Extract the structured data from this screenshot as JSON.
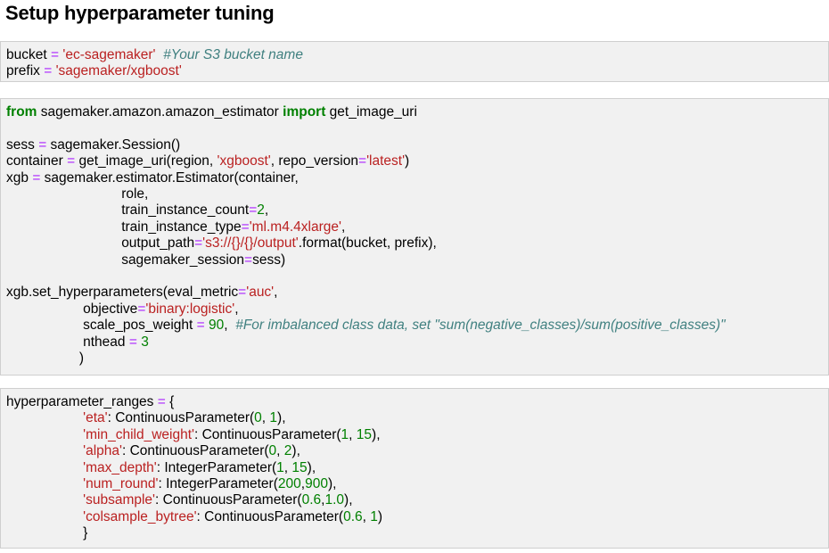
{
  "heading": "Setup hyperparameter tuning",
  "cells": [
    [
      [
        [
          "t",
          "bucket "
        ],
        [
          "op",
          "="
        ],
        [
          "t",
          " "
        ],
        [
          "str",
          "'ec-sagemaker'"
        ],
        [
          "t",
          "  "
        ],
        [
          "cm",
          "#Your S3 bucket name"
        ]
      ],
      [
        [
          "t",
          "prefix "
        ],
        [
          "op",
          "="
        ],
        [
          "t",
          " "
        ],
        [
          "str",
          "'sagemaker/xgboost'"
        ]
      ]
    ],
    [
      [
        [
          "kw",
          "from"
        ],
        [
          "t",
          " sagemaker.amazon.amazon_estimator "
        ],
        [
          "kw",
          "import"
        ],
        [
          "t",
          " get_image_uri"
        ]
      ],
      [],
      [
        [
          "t",
          "sess "
        ],
        [
          "op",
          "="
        ],
        [
          "t",
          " sagemaker.Session()"
        ]
      ],
      [
        [
          "t",
          "container "
        ],
        [
          "op",
          "="
        ],
        [
          "t",
          " get_image_uri(region, "
        ],
        [
          "str",
          "'xgboost'"
        ],
        [
          "t",
          ", repo_version"
        ],
        [
          "op",
          "="
        ],
        [
          "str",
          "'latest'"
        ],
        [
          "t",
          ")"
        ]
      ],
      [
        [
          "t",
          "xgb "
        ],
        [
          "op",
          "="
        ],
        [
          "t",
          " sagemaker.estimator.Estimator(container,"
        ]
      ],
      [
        [
          "t",
          "                              role,"
        ]
      ],
      [
        [
          "t",
          "                              train_instance_count"
        ],
        [
          "op",
          "="
        ],
        [
          "num",
          "2"
        ],
        [
          "t",
          ","
        ]
      ],
      [
        [
          "t",
          "                              train_instance_type"
        ],
        [
          "op",
          "="
        ],
        [
          "str",
          "'ml.m4.4xlarge'"
        ],
        [
          "t",
          ","
        ]
      ],
      [
        [
          "t",
          "                              output_path"
        ],
        [
          "op",
          "="
        ],
        [
          "str",
          "'s3://{}/{}/output'"
        ],
        [
          "t",
          ".format(bucket, prefix),"
        ]
      ],
      [
        [
          "t",
          "                              sagemaker_session"
        ],
        [
          "op",
          "="
        ],
        [
          "t",
          "sess)"
        ]
      ],
      [],
      [
        [
          "t",
          "xgb.set_hyperparameters(eval_metric"
        ],
        [
          "op",
          "="
        ],
        [
          "str",
          "'auc'"
        ],
        [
          "t",
          ","
        ]
      ],
      [
        [
          "t",
          "                    objective"
        ],
        [
          "op",
          "="
        ],
        [
          "str",
          "'binary:logistic'"
        ],
        [
          "t",
          ","
        ]
      ],
      [
        [
          "t",
          "                    scale_pos_weight "
        ],
        [
          "op",
          "="
        ],
        [
          "t",
          " "
        ],
        [
          "num",
          "90"
        ],
        [
          "t",
          ",  "
        ],
        [
          "cm",
          "#For imbalanced class data, set \"sum(negative_classes)/sum(positive_classes)\""
        ]
      ],
      [
        [
          "t",
          "                    nthead "
        ],
        [
          "op",
          "="
        ],
        [
          "t",
          " "
        ],
        [
          "num",
          "3"
        ]
      ],
      [
        [
          "t",
          "                   )"
        ]
      ]
    ],
    [
      [
        [
          "t",
          "hyperparameter_ranges "
        ],
        [
          "op",
          "="
        ],
        [
          "t",
          " {"
        ]
      ],
      [
        [
          "t",
          "                    "
        ],
        [
          "str",
          "'eta'"
        ],
        [
          "t",
          ": ContinuousParameter("
        ],
        [
          "num",
          "0"
        ],
        [
          "t",
          ", "
        ],
        [
          "num",
          "1"
        ],
        [
          "t",
          "),"
        ]
      ],
      [
        [
          "t",
          "                    "
        ],
        [
          "str",
          "'min_child_weight'"
        ],
        [
          "t",
          ": ContinuousParameter("
        ],
        [
          "num",
          "1"
        ],
        [
          "t",
          ", "
        ],
        [
          "num",
          "15"
        ],
        [
          "t",
          "),"
        ]
      ],
      [
        [
          "t",
          "                    "
        ],
        [
          "str",
          "'alpha'"
        ],
        [
          "t",
          ": ContinuousParameter("
        ],
        [
          "num",
          "0"
        ],
        [
          "t",
          ", "
        ],
        [
          "num",
          "2"
        ],
        [
          "t",
          "),"
        ]
      ],
      [
        [
          "t",
          "                    "
        ],
        [
          "str",
          "'max_depth'"
        ],
        [
          "t",
          ": IntegerParameter("
        ],
        [
          "num",
          "1"
        ],
        [
          "t",
          ", "
        ],
        [
          "num",
          "15"
        ],
        [
          "t",
          "),"
        ]
      ],
      [
        [
          "t",
          "                    "
        ],
        [
          "str",
          "'num_round'"
        ],
        [
          "t",
          ": IntegerParameter("
        ],
        [
          "num",
          "200"
        ],
        [
          "t",
          ","
        ],
        [
          "num",
          "900"
        ],
        [
          "t",
          "),"
        ]
      ],
      [
        [
          "t",
          "                    "
        ],
        [
          "str",
          "'subsample'"
        ],
        [
          "t",
          ": ContinuousParameter("
        ],
        [
          "num",
          "0.6"
        ],
        [
          "t",
          ","
        ],
        [
          "num",
          "1.0"
        ],
        [
          "t",
          "),"
        ]
      ],
      [
        [
          "t",
          "                    "
        ],
        [
          "str",
          "'colsample_bytree'"
        ],
        [
          "t",
          ": ContinuousParameter("
        ],
        [
          "num",
          "0.6"
        ],
        [
          "t",
          ", "
        ],
        [
          "num",
          "1"
        ],
        [
          "t",
          ")"
        ]
      ],
      [
        [
          "t",
          "                    }"
        ]
      ]
    ]
  ]
}
